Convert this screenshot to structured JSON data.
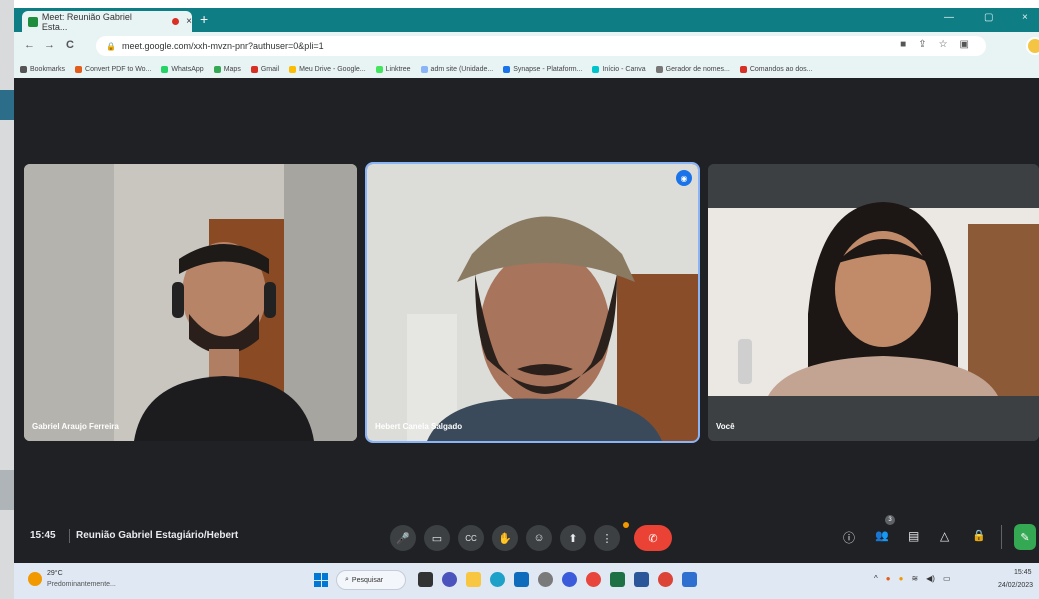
{
  "browser": {
    "tab_title": "Meet: Reunião Gabriel Esta...",
    "tab_close": "×",
    "new_tab": "+",
    "url": "meet.google.com/xxh-mvzn-pnr?authuser=0&pli=1",
    "nav": {
      "back": "←",
      "forward": "→",
      "reload": "C"
    },
    "window": {
      "minimize": "—",
      "maximize": "▢",
      "close": "×"
    }
  },
  "bookmarks": [
    {
      "label": "Bookmarks",
      "color": "#555555"
    },
    {
      "label": "Convert PDF to Wo...",
      "color": "#e25c1b"
    },
    {
      "label": "WhatsApp",
      "color": "#25d366"
    },
    {
      "label": "Maps",
      "color": "#34a853"
    },
    {
      "label": "Gmail",
      "color": "#d93025"
    },
    {
      "label": "Meu Drive - Google...",
      "color": "#fbbc04"
    },
    {
      "label": "Linktree",
      "color": "#43e55e"
    },
    {
      "label": "adm site (Unidade...",
      "color": "#8ab4f8"
    },
    {
      "label": "Synapse - Plataform...",
      "color": "#1a73e8"
    },
    {
      "label": "Início - Canva",
      "color": "#00c4cc"
    },
    {
      "label": "Gerador de nomes...",
      "color": "#777777"
    },
    {
      "label": "Comandos ao dos...",
      "color": "#d93025"
    }
  ],
  "participants": [
    {
      "name": "Gabriel Araujo Ferreira"
    },
    {
      "name": "Hebert Canela Salgado",
      "speaking": true
    },
    {
      "name": "Você"
    }
  ],
  "meeting": {
    "time": "15:45",
    "title": "Reunião Gabriel Estagiário/Hebert",
    "participant_count": "3"
  },
  "controls": {
    "mic": "🎤",
    "camera": "▭",
    "captions": "CC",
    "raise_hand": "✋",
    "emoji": "☺",
    "present": "⬆",
    "more": "⋮",
    "leave": "✆"
  },
  "right_controls": {
    "info": "ⓘ",
    "people": "👥",
    "chat": "▤",
    "activities": "△",
    "host": "🔒",
    "activities_panel": "✎"
  },
  "taskbar": {
    "weather_temp": "29°C",
    "weather_desc": "Predominantemente...",
    "search_label": "Pesquisar",
    "clock_time": "15:45",
    "clock_date": "24/02/2023"
  },
  "colors": {
    "meet_bg": "#202124",
    "tile_bg": "#3c4043",
    "leave": "#ea4335",
    "activities": "#34a853",
    "chrome_frame": "#0e7d84",
    "speaking_outline": "#8ab4f8"
  }
}
